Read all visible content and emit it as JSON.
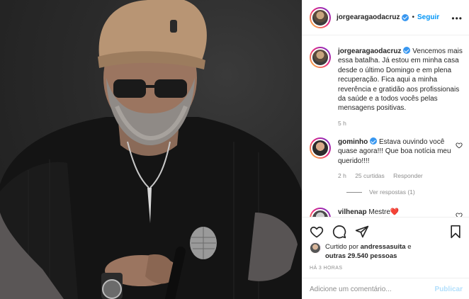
{
  "post": {
    "username": "jorgearagaodacruz",
    "follow_label": "Seguir",
    "dot": "•",
    "more_label": "•••",
    "caption": "Vencemos mais essa batalha. Já estou em minha casa desde o último Domingo e em plena recuperação. Fica aqui a minha reverência e gratidão aos profissionais da saúde e a todos vocês pelas mensagens positivas.",
    "caption_age": "5 h"
  },
  "comments": [
    {
      "username": "gominho",
      "text": "Estava ouvindo você quase agora!!! Que boa notícia meu querido!!!!",
      "age": "2 h",
      "likes": "25 curtidas",
      "reply_label": "Responder",
      "view_replies": "Ver respostas (1)"
    },
    {
      "username": "vilhenap",
      "text": "Mestre❤️"
    }
  ],
  "actions": {
    "liked_prefix": "Curtido por",
    "liked_user": "andressasuita",
    "liked_and": "e",
    "liked_others": "outras 29.540 pessoas",
    "timestamp": "HÁ 3 HORAS",
    "comment_placeholder": "Adicione um comentário...",
    "publish_label": "Publicar"
  },
  "icons": [
    "heart-icon",
    "comment-icon",
    "share-icon",
    "bookmark-icon",
    "verified-badge-icon",
    "emoji-icon"
  ],
  "colors": {
    "accent": "#0095f6",
    "verified": "#3897f0",
    "muted": "#8e8e8e",
    "publish_disabled": "#b2dffc"
  }
}
